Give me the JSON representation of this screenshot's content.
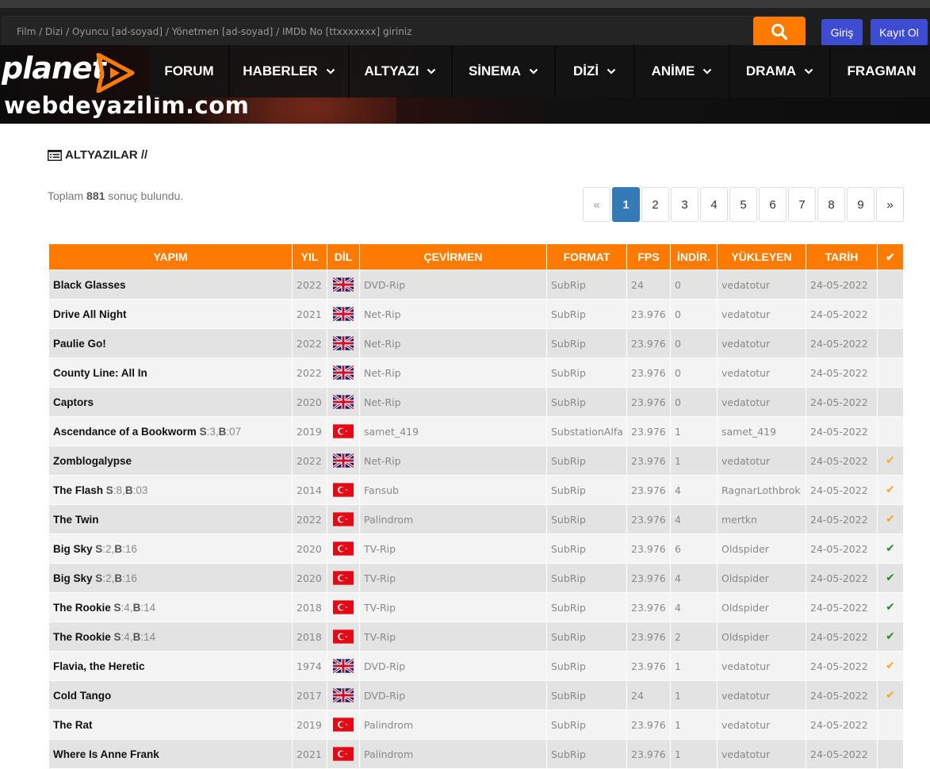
{
  "search": {
    "placeholder": "Film / Dizi / Oyuncu [ad-soyad] / Yönetmen [ad-soyad] / IMDb No [ttxxxxxxx] giriniz"
  },
  "auth": {
    "login": "Giriş",
    "register": "Kayıt Ol"
  },
  "brand": {
    "logo": "planet",
    "watermark": "webdeyazilim.com"
  },
  "nav": [
    {
      "label": "FORUM",
      "dropdown": false
    },
    {
      "label": "HABERLER",
      "dropdown": true
    },
    {
      "label": "ALTYAZI",
      "dropdown": true
    },
    {
      "label": "SİNEMA",
      "dropdown": true
    },
    {
      "label": "DİZİ",
      "dropdown": true
    },
    {
      "label": "ANİME",
      "dropdown": true
    },
    {
      "label": "DRAMA",
      "dropdown": true
    },
    {
      "label": "FRAGMAN",
      "dropdown": false
    }
  ],
  "section": {
    "title": "ALTYAZILAR //"
  },
  "results": {
    "prefix": "Toplam",
    "count": "881",
    "suffix": "sonuç bulundu."
  },
  "pagination": {
    "prev": "«",
    "pages": [
      "1",
      "2",
      "3",
      "4",
      "5",
      "6",
      "7",
      "8",
      "9"
    ],
    "current": "1",
    "next": "»"
  },
  "table": {
    "headers": [
      "YAPIM",
      "YIL",
      "DİL",
      "ÇEVİRMEN",
      "FORMAT",
      "FPS",
      "İNDİR.",
      "YÜKLEYEN",
      "TARİH",
      "✔"
    ],
    "colors": {
      "check_orange": "#f5a623",
      "check_green": "#2a8a2a",
      "accent": "#ff7b00"
    },
    "rows": [
      {
        "title": "Black Glasses",
        "ep": null,
        "year": "2022",
        "lang": "uk",
        "translator": "DVD-Rip",
        "format": "SubRip",
        "fps": "24",
        "downloads": "0",
        "uploader": "vedatotur",
        "date": "24-05-2022",
        "check": ""
      },
      {
        "title": "Drive All Night",
        "ep": null,
        "year": "2021",
        "lang": "uk",
        "translator": "Net-Rip",
        "format": "SubRip",
        "fps": "23.976",
        "downloads": "0",
        "uploader": "vedatotur",
        "date": "24-05-2022",
        "check": ""
      },
      {
        "title": "Paulie Go!",
        "ep": null,
        "year": "2022",
        "lang": "uk",
        "translator": "Net-Rip",
        "format": "SubRip",
        "fps": "23.976",
        "downloads": "0",
        "uploader": "vedatotur",
        "date": "24-05-2022",
        "check": ""
      },
      {
        "title": "County Line: All In",
        "ep": null,
        "year": "2022",
        "lang": "uk",
        "translator": "Net-Rip",
        "format": "SubRip",
        "fps": "23.976",
        "downloads": "0",
        "uploader": "vedatotur",
        "date": "24-05-2022",
        "check": ""
      },
      {
        "title": "Captors",
        "ep": null,
        "year": "2020",
        "lang": "uk",
        "translator": "Net-Rip",
        "format": "SubRip",
        "fps": "23.976",
        "downloads": "0",
        "uploader": "vedatotur",
        "date": "24-05-2022",
        "check": ""
      },
      {
        "title": "Ascendance of a Bookworm",
        "ep": {
          "s": "3",
          "b": "07"
        },
        "year": "2019",
        "lang": "tr",
        "translator": "samet_419",
        "format": "SubstationAlfa",
        "fps": "23.976",
        "downloads": "1",
        "uploader": "samet_419",
        "date": "24-05-2022",
        "check": ""
      },
      {
        "title": "Zomblogalypse",
        "ep": null,
        "year": "2022",
        "lang": "uk",
        "translator": "Net-Rip",
        "format": "SubRip",
        "fps": "23.976",
        "downloads": "1",
        "uploader": "vedatotur",
        "date": "24-05-2022",
        "check": "orange"
      },
      {
        "title": "The Flash",
        "ep": {
          "s": "8",
          "b": "03"
        },
        "year": "2014",
        "lang": "tr",
        "translator": "Fansub",
        "format": "SubRip",
        "fps": "23.976",
        "downloads": "4",
        "uploader": "RagnarLothbrok",
        "date": "24-05-2022",
        "check": "orange"
      },
      {
        "title": "The Twin",
        "ep": null,
        "year": "2022",
        "lang": "tr",
        "translator": "Palindrom",
        "format": "SubRip",
        "fps": "23.976",
        "downloads": "4",
        "uploader": "mertkn",
        "date": "24-05-2022",
        "check": "orange"
      },
      {
        "title": "Big Sky",
        "ep": {
          "s": "2",
          "b": "16"
        },
        "year": "2020",
        "lang": "tr",
        "translator": "TV-Rip",
        "format": "SubRip",
        "fps": "23.976",
        "downloads": "6",
        "uploader": "Oldspider",
        "date": "24-05-2022",
        "check": "green"
      },
      {
        "title": "Big Sky",
        "ep": {
          "s": "2",
          "b": "16"
        },
        "year": "2020",
        "lang": "tr",
        "translator": "TV-Rip",
        "format": "SubRip",
        "fps": "23.976",
        "downloads": "4",
        "uploader": "Oldspider",
        "date": "24-05-2022",
        "check": "green"
      },
      {
        "title": "The Rookie",
        "ep": {
          "s": "4",
          "b": "14"
        },
        "year": "2018",
        "lang": "tr",
        "translator": "TV-Rip",
        "format": "SubRip",
        "fps": "23.976",
        "downloads": "4",
        "uploader": "Oldspider",
        "date": "24-05-2022",
        "check": "green"
      },
      {
        "title": "The Rookie",
        "ep": {
          "s": "4",
          "b": "14"
        },
        "year": "2018",
        "lang": "tr",
        "translator": "TV-Rip",
        "format": "SubRip",
        "fps": "23.976",
        "downloads": "2",
        "uploader": "Oldspider",
        "date": "24-05-2022",
        "check": "green"
      },
      {
        "title": "Flavia, the Heretic",
        "ep": null,
        "year": "1974",
        "lang": "uk",
        "translator": "DVD-Rip",
        "format": "SubRip",
        "fps": "23.976",
        "downloads": "1",
        "uploader": "vedatotur",
        "date": "24-05-2022",
        "check": "orange"
      },
      {
        "title": "Cold Tango",
        "ep": null,
        "year": "2017",
        "lang": "uk",
        "translator": "DVD-Rip",
        "format": "SubRip",
        "fps": "24",
        "downloads": "1",
        "uploader": "vedatotur",
        "date": "24-05-2022",
        "check": "orange"
      },
      {
        "title": "The Rat",
        "ep": null,
        "year": "2019",
        "lang": "tr",
        "translator": "Palindrom",
        "format": "SubRip",
        "fps": "23.976",
        "downloads": "1",
        "uploader": "vedatotur",
        "date": "24-05-2022",
        "check": ""
      },
      {
        "title": "Where Is Anne Frank",
        "ep": null,
        "year": "2021",
        "lang": "tr",
        "translator": "Palindrom",
        "format": "SubRip",
        "fps": "23.976",
        "downloads": "1",
        "uploader": "vedatotur",
        "date": "24-05-2022",
        "check": ""
      }
    ]
  }
}
